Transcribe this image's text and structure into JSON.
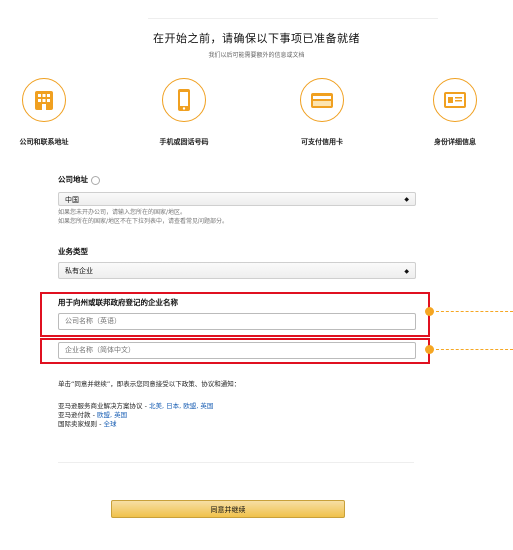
{
  "header": {
    "title": "在开始之前，请确保以下事项已准备就绪",
    "subtitle": "我们以后可能需要额外的信息或文档"
  },
  "steps": [
    {
      "label": "公司和联系地址",
      "icon": "building-icon"
    },
    {
      "label": "手机或固话号码",
      "icon": "phone-icon"
    },
    {
      "label": "可支付信用卡",
      "icon": "credit-card-icon"
    },
    {
      "label": "身份详细信息",
      "icon": "id-card-icon"
    }
  ],
  "form": {
    "address_label": "公司地址",
    "country_value": "中国",
    "hint_1": "如果您未开办公司，请输入您所在的国家/地区。",
    "hint_2": "如果您所在的国家/地区不在下拉列表中，请查看常见问题部分。",
    "business_type_label": "业务类型",
    "business_type_value": "私有企业",
    "company_name_label": "用于向州或联邦政府登记的企业名称",
    "name_en_placeholder": "公司名称（英语）",
    "name_cn_placeholder": "企业名称（简体中文）"
  },
  "agreement": {
    "intro": "单击“同意并继续”，即表示您同意接受以下政策、协议和通知：",
    "line1_text": "亚马逊服务商业解决方案协议 - ",
    "line1_links": "北美, 日本, 欧盟, 英国",
    "line2_text": "亚马逊付款 - ",
    "line2_links": "欧盟, 英国",
    "line3_text": "国际卖家规则 - ",
    "line3_links": "全球"
  },
  "submit_label": "同意并继续",
  "colors": {
    "accent": "#f0a020",
    "highlight": "#e01020",
    "button": "#f0c14b",
    "link": "#1a5fb4"
  }
}
